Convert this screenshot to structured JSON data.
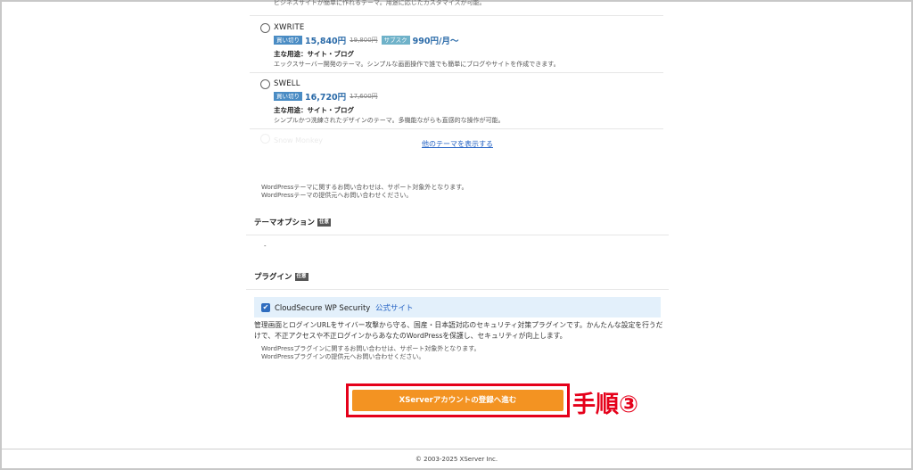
{
  "themes_list": {
    "prev_desc": "ビジネスサイトが簡単に作れるテーマ。用途に応じたカスタマイズが可能。",
    "items": [
      {
        "name": "XWRITE",
        "buy_badge": "買い切り",
        "price": "15,840円",
        "old_price": "19,800円",
        "sub_badge": "サブスク",
        "sub_price": "990円/月〜",
        "use": "主な用途：サイト・ブログ",
        "desc": "エックスサーバー開発のテーマ。シンプルな画面操作で誰でも簡単にブログやサイトを作成できます。"
      },
      {
        "name": "SWELL",
        "buy_badge": "買い切り",
        "price": "16,720円",
        "old_price": "17,600円",
        "use": "主な用途：サイト・ブログ",
        "desc": "シンプルかつ洗練されたデザインのテーマ。多機能ながらも直感的な操作が可能。"
      }
    ],
    "faded_name": "Snow Monkey",
    "faded_desc": "",
    "show_more": "他のテーマを表示する",
    "note_line1": "WordPressテーマに関するお問い合わせは、サポート対象外となります。",
    "note_line2": "WordPressテーマの提供元へお問い合わせください。"
  },
  "theme_option": {
    "title": "テーマオプション",
    "tag": "任意",
    "value": "-"
  },
  "plugin": {
    "title": "プラグイン",
    "tag": "任意",
    "name": "CloudSecure WP Security",
    "link": "公式サイト",
    "checked": true,
    "check_mark": "✔",
    "desc": "管理画面とログインURLをサイバー攻撃から守る、国産・日本語対応のセキュリティ対策プラグインです。かんたんな設定を行うだけで、不正アクセスや不正ログインからあなたのWordPressを保護し、セキュリティが向上します。",
    "note_line1": "WordPressプラグインに関するお問い合わせは、サポート対象外となります。",
    "note_line2": "WordPressプラグインの提供元へお問い合わせください。"
  },
  "cta": {
    "label": "XServerアカウントの登録へ進む",
    "step_label": "手順③"
  },
  "footer": {
    "copyright": "© 2003-2025 XServer Inc."
  },
  "colors": {
    "cta": "#f39322",
    "highlight": "#e5001a",
    "link": "#2563c4"
  }
}
